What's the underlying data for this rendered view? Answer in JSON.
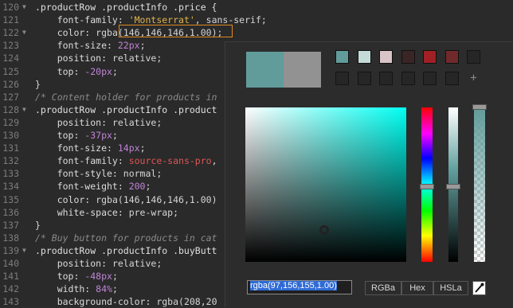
{
  "editor": {
    "lines": [
      {
        "n": "120",
        "fold": "▼",
        "parts": [
          [
            "sel",
            ".productRow .productInfo .price {"
          ]
        ]
      },
      {
        "n": "121",
        "fold": "",
        "parts": [
          [
            "prop",
            "    font-family: "
          ],
          [
            "str",
            "'Montserrat'"
          ],
          [
            "val",
            ", sans-serif;"
          ]
        ]
      },
      {
        "n": "122",
        "fold": "▼",
        "parts": [
          [
            "prop",
            "    color: "
          ],
          [
            "val",
            "rgba(146,146,146,1.00);"
          ]
        ]
      },
      {
        "n": "123",
        "fold": "",
        "parts": [
          [
            "prop",
            "    font-size: "
          ],
          [
            "num",
            "22px"
          ],
          [
            "val",
            ";"
          ]
        ]
      },
      {
        "n": "124",
        "fold": "",
        "parts": [
          [
            "prop",
            "    position: "
          ],
          [
            "val",
            "relative;"
          ]
        ]
      },
      {
        "n": "125",
        "fold": "",
        "parts": [
          [
            "prop",
            "    top: "
          ],
          [
            "num",
            "-20px"
          ],
          [
            "val",
            ";"
          ]
        ]
      },
      {
        "n": "126",
        "fold": "",
        "parts": [
          [
            "val",
            "}"
          ]
        ]
      },
      {
        "n": "127",
        "fold": "",
        "parts": [
          [
            "cmt",
            "/* Content holder for products in"
          ]
        ]
      },
      {
        "n": "128",
        "fold": "▼",
        "parts": [
          [
            "sel",
            ".productRow .productInfo .product"
          ]
        ]
      },
      {
        "n": "129",
        "fold": "",
        "parts": [
          [
            "prop",
            "    position: "
          ],
          [
            "val",
            "relative;"
          ]
        ]
      },
      {
        "n": "130",
        "fold": "",
        "parts": [
          [
            "prop",
            "    top: "
          ],
          [
            "num",
            "-37px"
          ],
          [
            "val",
            ";"
          ]
        ]
      },
      {
        "n": "131",
        "fold": "",
        "parts": [
          [
            "prop",
            "    font-size: "
          ],
          [
            "num",
            "14px"
          ],
          [
            "val",
            ";"
          ]
        ]
      },
      {
        "n": "132",
        "fold": "",
        "parts": [
          [
            "prop",
            "    font-family: "
          ],
          [
            "red",
            "source-sans-pro"
          ],
          [
            "val",
            ","
          ]
        ]
      },
      {
        "n": "133",
        "fold": "",
        "parts": [
          [
            "prop",
            "    font-style: "
          ],
          [
            "val",
            "normal;"
          ]
        ]
      },
      {
        "n": "134",
        "fold": "",
        "parts": [
          [
            "prop",
            "    font-weight: "
          ],
          [
            "num",
            "200"
          ],
          [
            "val",
            ";"
          ]
        ]
      },
      {
        "n": "135",
        "fold": "",
        "parts": [
          [
            "prop",
            "    color: "
          ],
          [
            "val",
            "rgba(146,146,146,1.00)"
          ]
        ]
      },
      {
        "n": "136",
        "fold": "",
        "parts": [
          [
            "prop",
            "    white-space: "
          ],
          [
            "val",
            "pre-wrap;"
          ]
        ]
      },
      {
        "n": "137",
        "fold": "",
        "parts": [
          [
            "val",
            "}"
          ]
        ]
      },
      {
        "n": "138",
        "fold": "",
        "parts": [
          [
            "cmt",
            "/* Buy button for products in cat"
          ]
        ]
      },
      {
        "n": "139",
        "fold": "▼",
        "parts": [
          [
            "sel",
            ".productRow .productInfo .buyButt"
          ]
        ]
      },
      {
        "n": "140",
        "fold": "",
        "parts": [
          [
            "prop",
            "    position: "
          ],
          [
            "val",
            "relative;"
          ]
        ]
      },
      {
        "n": "141",
        "fold": "",
        "parts": [
          [
            "prop",
            "    top: "
          ],
          [
            "num",
            "-48px"
          ],
          [
            "val",
            ";"
          ]
        ]
      },
      {
        "n": "142",
        "fold": "",
        "parts": [
          [
            "prop",
            "    width: "
          ],
          [
            "num",
            "84%"
          ],
          [
            "val",
            ";"
          ]
        ]
      },
      {
        "n": "143",
        "fold": "",
        "parts": [
          [
            "prop",
            "    background-color: "
          ],
          [
            "val",
            "rgba(208,20"
          ]
        ]
      }
    ]
  },
  "picker": {
    "current_color": "#619c9b",
    "original_color": "#929292",
    "swatches": [
      "#619c9b",
      "#c5dbd8",
      "#d9c4c8",
      "#3a2526",
      "#a02024",
      "#702a2c",
      "empty",
      "empty",
      "empty",
      "empty",
      "empty",
      "empty",
      "empty",
      "add"
    ],
    "input_value": "rgba(97,156,155,1.00)",
    "formats": [
      "RGBa",
      "Hex",
      "HSLa"
    ],
    "eyedropper_icon": "eyedropper-icon"
  }
}
